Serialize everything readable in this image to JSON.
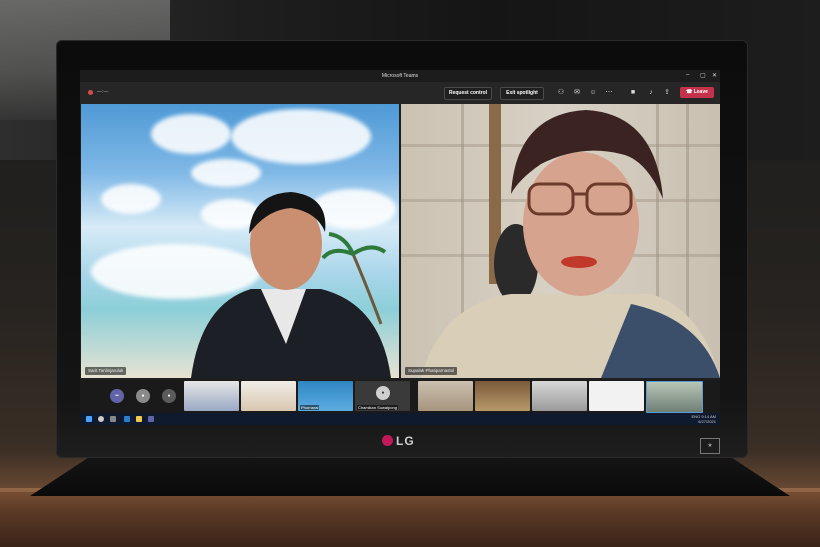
{
  "window": {
    "title": "Microsoft Teams"
  },
  "meeting": {
    "timer": "—:—"
  },
  "toolbar": {
    "request_control": "Request control",
    "exit_spotlight": "Exit spotlight",
    "leave": "Leave",
    "icons": [
      "people-icon",
      "chat-icon",
      "reactions-icon",
      "more-icon",
      "camera-icon",
      "mic-icon",
      "share-icon"
    ]
  },
  "participants": {
    "main_left": {
      "name": "Sarit Tanlinjaruluk"
    },
    "main_right": {
      "name": "Supalak Phatiparnastol"
    },
    "strip": [
      {
        "label": "Chamikan Suwalpong"
      },
      {
        "label": "Phornarai"
      }
    ]
  },
  "device": {
    "brand": "LG"
  },
  "taskbar": {
    "lang": "ENG",
    "time": "9:14 AM",
    "date": "6/27/2021"
  },
  "colors": {
    "leave": "#c4314b",
    "record": "#d94a4a",
    "taskbar": "#101a2e"
  }
}
